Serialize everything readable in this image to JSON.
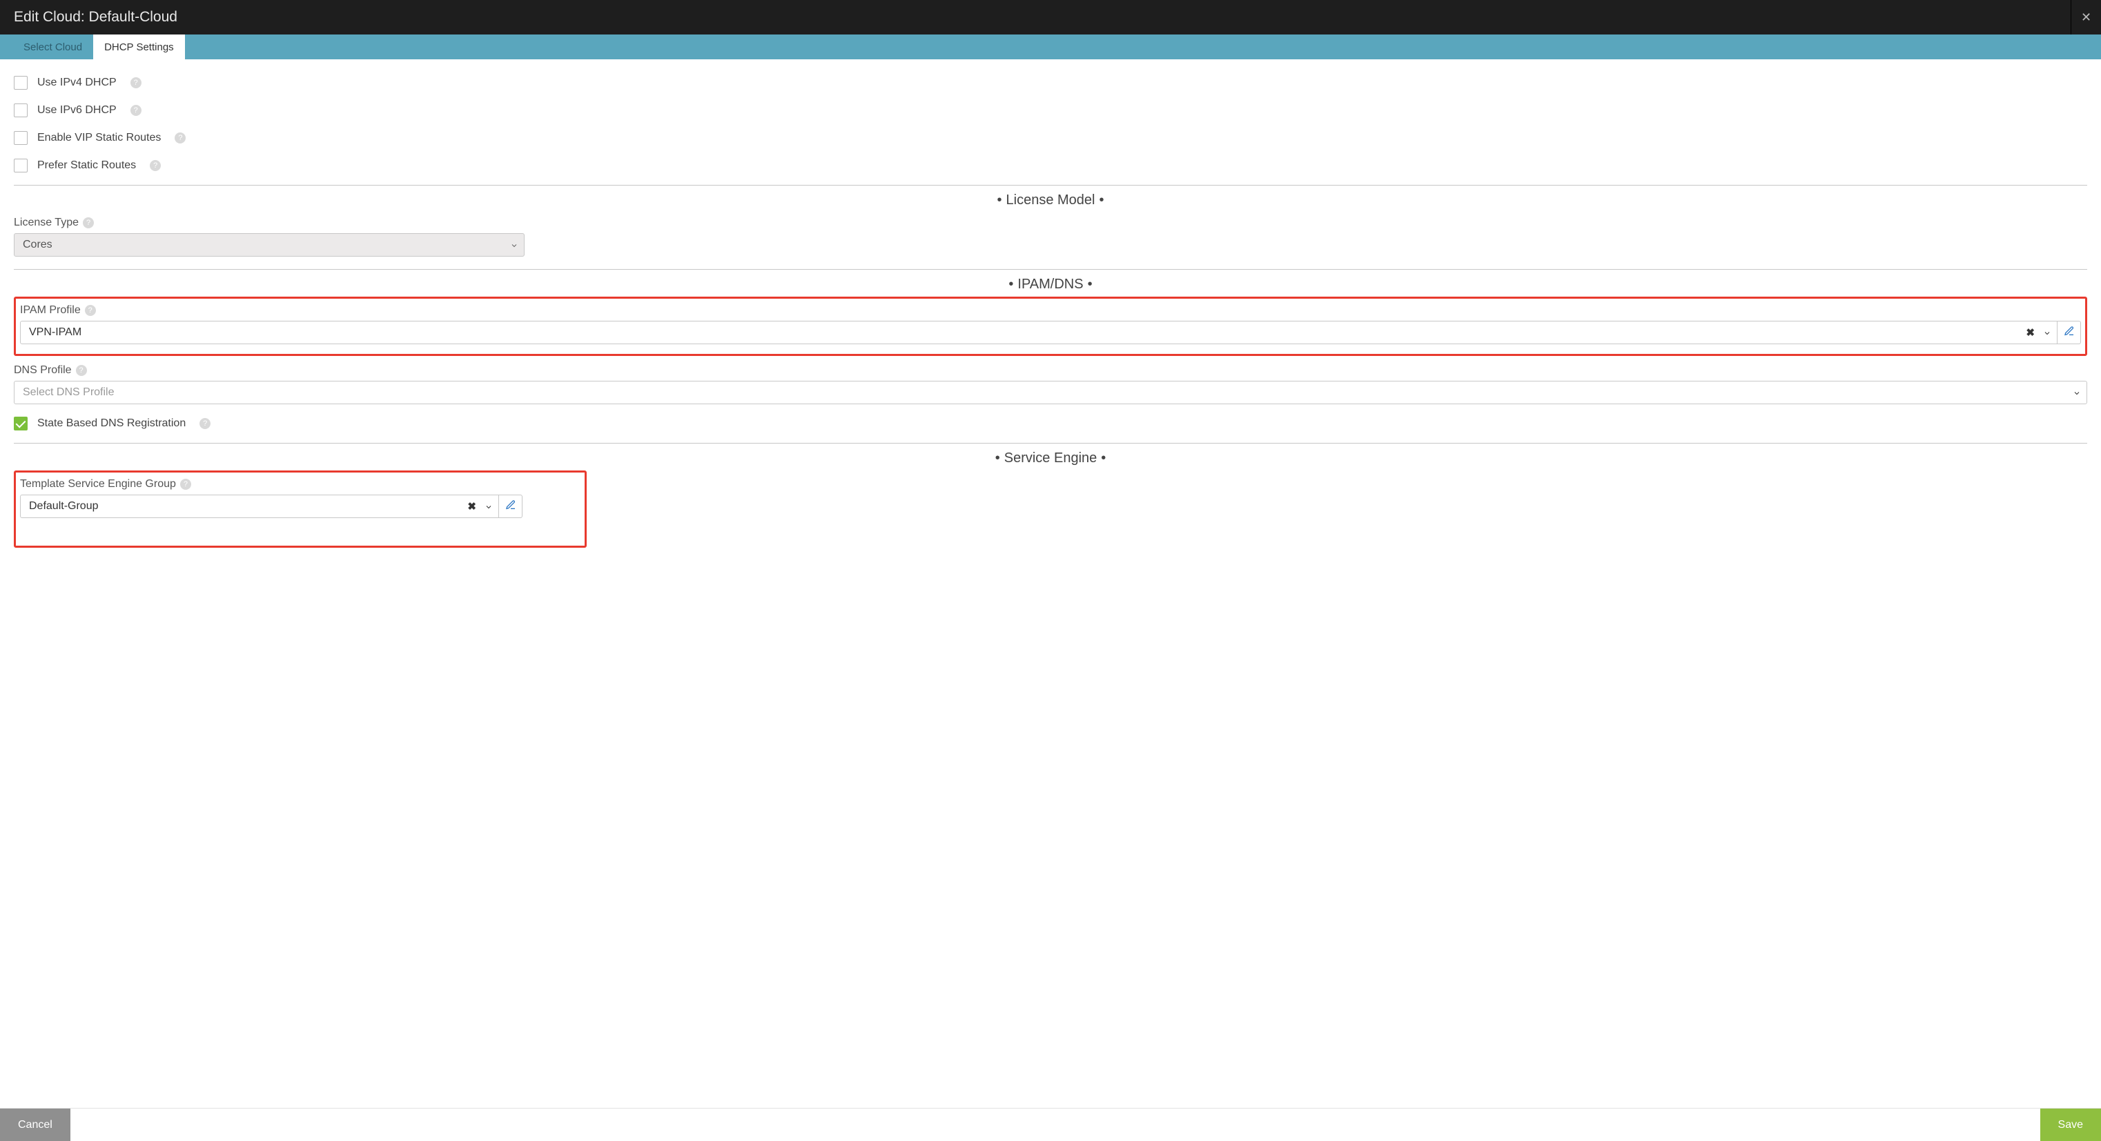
{
  "header": {
    "title": "Edit Cloud: Default-Cloud"
  },
  "tabs": {
    "select_cloud": "Select Cloud",
    "dhcp_settings": "DHCP Settings"
  },
  "checks": {
    "ipv4": "Use IPv4 DHCP",
    "ipv6": "Use IPv6 DHCP",
    "vip_static": "Enable VIP Static Routes",
    "prefer_static": "Prefer Static Routes",
    "state_dns": "State Based DNS Registration"
  },
  "sections": {
    "license": "License Model",
    "ipamdns": "IPAM/DNS",
    "service_engine": "Service Engine"
  },
  "license": {
    "type_label": "License Type",
    "type_value": "Cores"
  },
  "ipam": {
    "profile_label": "IPAM Profile",
    "profile_value": "VPN-IPAM",
    "dns_label": "DNS Profile",
    "dns_placeholder": "Select DNS Profile"
  },
  "seg": {
    "label": "Template Service Engine Group",
    "value": "Default-Group"
  },
  "footer": {
    "cancel": "Cancel",
    "save": "Save"
  },
  "glyphs": {
    "help": "?",
    "close": "✕",
    "clear": "✖"
  }
}
